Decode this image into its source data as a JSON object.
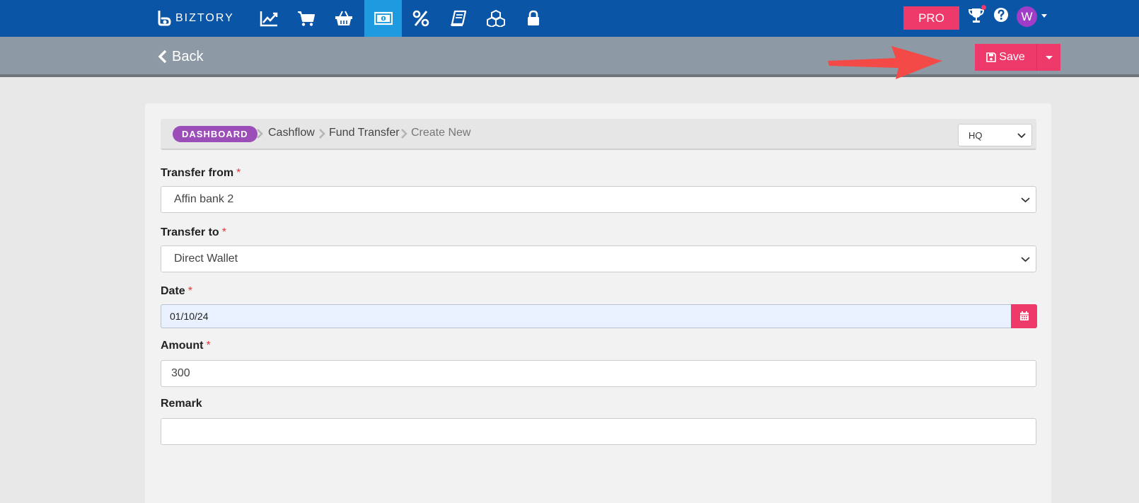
{
  "brand": {
    "name": "BIZTORY"
  },
  "nav": {
    "items": [
      {
        "icon": "chart-line-icon",
        "active": false
      },
      {
        "icon": "shopping-cart-icon",
        "active": false
      },
      {
        "icon": "basket-icon",
        "active": false
      },
      {
        "icon": "money-bill-icon",
        "active": true
      },
      {
        "icon": "percent-icon",
        "active": false
      },
      {
        "icon": "book-icon",
        "active": false
      },
      {
        "icon": "cubes-icon",
        "active": false
      },
      {
        "icon": "lock-icon",
        "active": false
      }
    ],
    "pro_label": "PRO",
    "avatar_initial": "W"
  },
  "actionbar": {
    "back_label": "Back",
    "save_label": "Save"
  },
  "breadcrumb": {
    "dashboard": "DASHBOARD",
    "items": [
      "Cashflow",
      "Fund Transfer",
      "Create New"
    ]
  },
  "branch": {
    "selected": "HQ"
  },
  "form": {
    "transfer_from": {
      "label": "Transfer from",
      "required": "*",
      "value": "Affin bank 2"
    },
    "transfer_to": {
      "label": "Transfer to",
      "required": "*",
      "value": "Direct Wallet"
    },
    "date": {
      "label": "Date",
      "required": "*",
      "value": "01/10/24"
    },
    "amount": {
      "label": "Amount",
      "required": "*",
      "value": "300"
    },
    "remark": {
      "label": "Remark",
      "value": ""
    }
  },
  "colors": {
    "nav_bg": "#0a55a6",
    "nav_active": "#1e9be0",
    "accent": "#ee3a6a",
    "actionbar_bg": "#8d9aa5",
    "dashboard_badge": "#9b4db8"
  }
}
